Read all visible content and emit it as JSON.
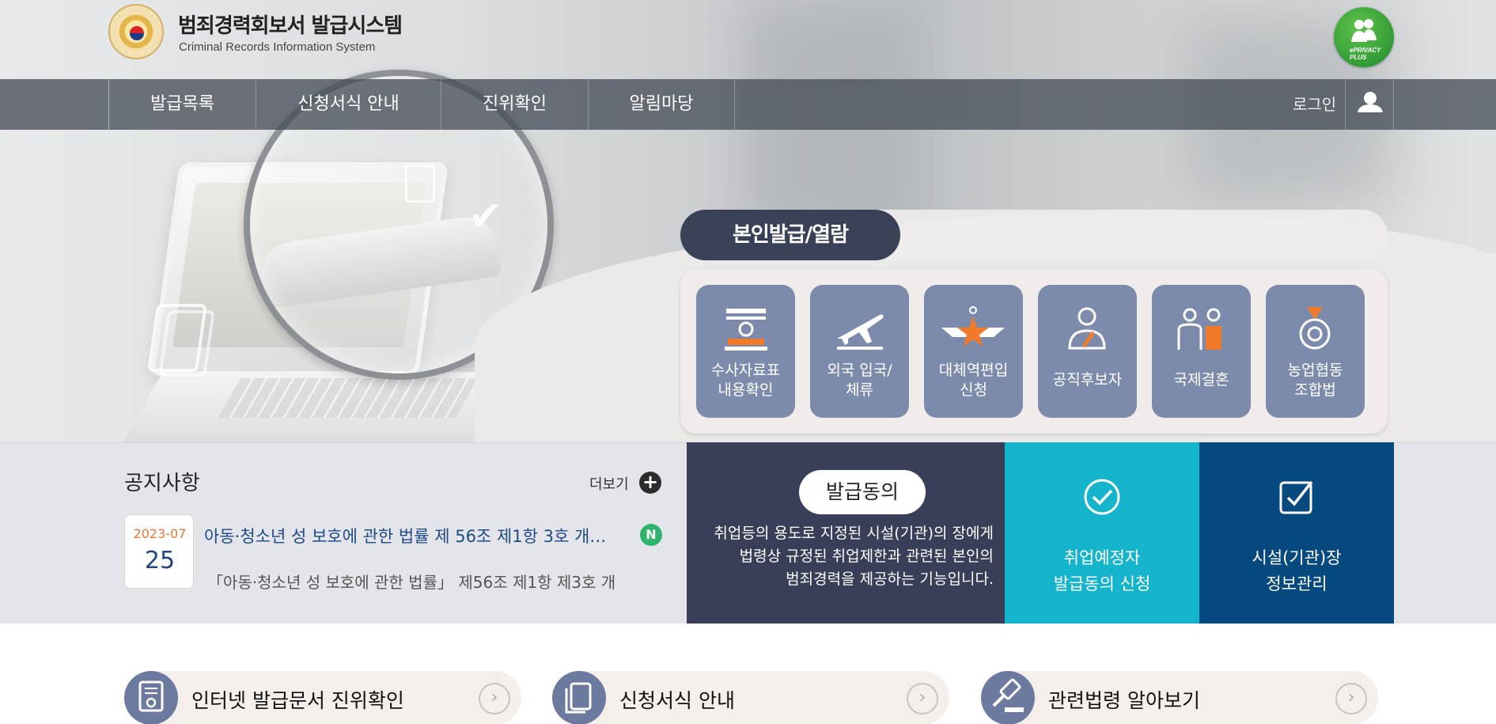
{
  "header": {
    "title": "범죄경력회보서 발급시스템",
    "subtitle": "Criminal Records Information System",
    "badge_text": "ePRIVACY PLUS"
  },
  "nav": {
    "items": [
      {
        "label": "발급목록"
      },
      {
        "label": "신청서식 안내"
      },
      {
        "label": "진위확인"
      },
      {
        "label": "알림마당"
      }
    ],
    "login_label": "로그인"
  },
  "self_issue": {
    "title": "본인발급/열람",
    "services": [
      {
        "label_line1": "수사자료표",
        "label_line2": "내용확인",
        "icon": "document-stamp-icon"
      },
      {
        "label_line1": "외국 입국/",
        "label_line2": "체류",
        "icon": "airplane-icon"
      },
      {
        "label_line1": "대체역편입",
        "label_line2": "신청",
        "icon": "military-emblem-icon"
      },
      {
        "label_line1": "공직후보자",
        "label_line2": "",
        "icon": "candidate-person-icon"
      },
      {
        "label_line1": "국제결혼",
        "label_line2": "",
        "icon": "couple-icon"
      },
      {
        "label_line1": "농업협동",
        "label_line2": "조합법",
        "icon": "medal-icon"
      }
    ]
  },
  "notice": {
    "title": "공지사항",
    "more_label": "더보기",
    "item": {
      "year_month": "2023-07",
      "day": "25",
      "headline": "아동·청소년 성 보호에 관한 법률 제 56조 제1항 3호 개…",
      "badge": "N",
      "excerpt": "「아동·청소년 성 보호에 관한 법률」 제56조 제1항 제3호 개"
    }
  },
  "consent": {
    "pill_label": "발급동의",
    "desc_line1": "취업등의 용도로 지정된 시설(기관)의 장에게",
    "desc_line2": "법령상 규정된 취업제한과 관련된 본인의",
    "desc_line3": "범죄경력을 제공하는 기능입니다."
  },
  "tiles": [
    {
      "line1": "취업예정자",
      "line2": "발급동의 신청",
      "color": "#14b4cd",
      "icon": "check-circle-icon"
    },
    {
      "line1": "시설(기관)장",
      "line2": "정보관리",
      "color": "#06497e",
      "icon": "check-square-icon"
    }
  ],
  "quick_links": [
    {
      "label": "인터넷 발급문서 진위확인",
      "icon": "certificate-icon"
    },
    {
      "label": "신청서식 안내",
      "icon": "documents-icon"
    },
    {
      "label": "관련법령 알아보기",
      "icon": "gavel-icon"
    }
  ],
  "colors": {
    "nav_bg": "#484e5a",
    "primary_dark": "#394158",
    "service_card": "#7c8bab",
    "accent_orange": "#e4773a",
    "new_badge": "#2fb36d"
  }
}
